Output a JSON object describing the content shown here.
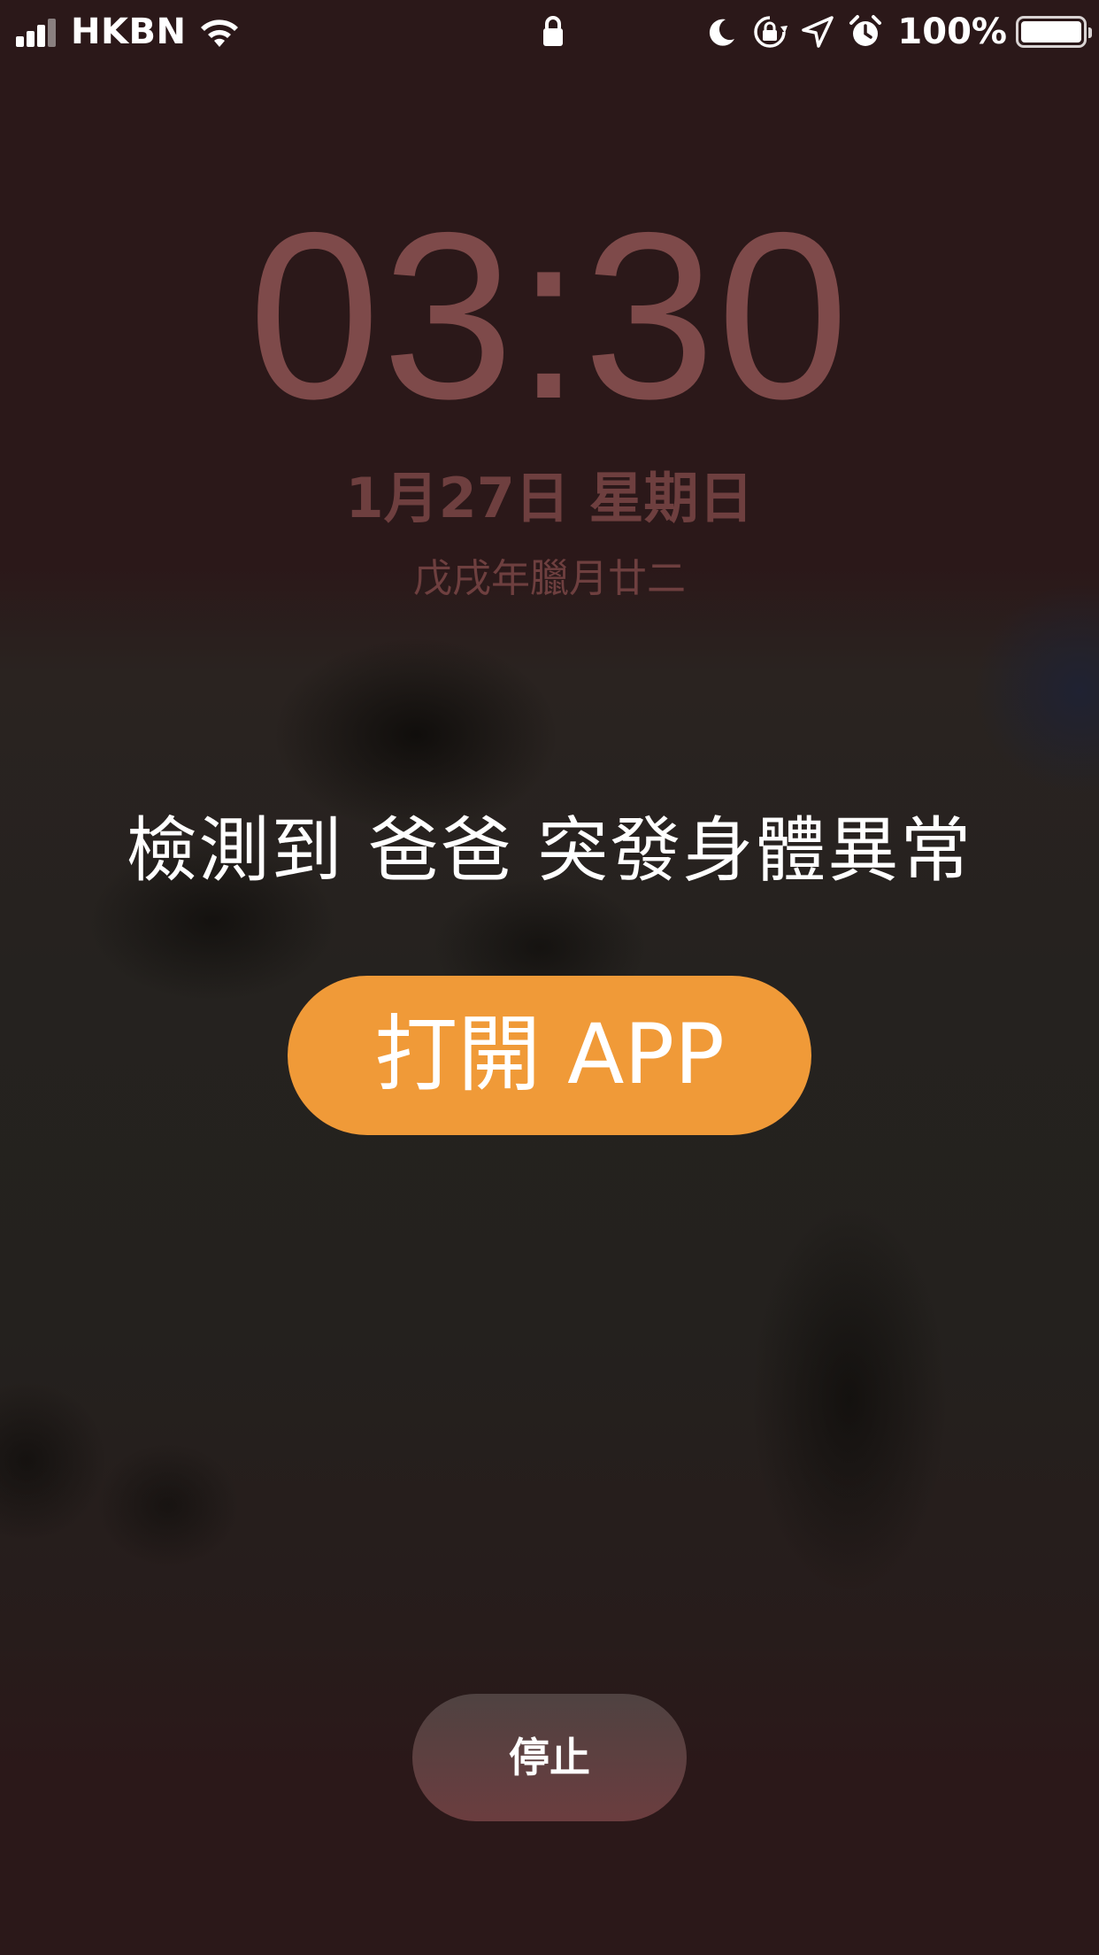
{
  "status_bar": {
    "carrier": "HKBN",
    "battery_percent": "100%",
    "signal_bars": 4,
    "signal_bars_active": 3,
    "icons": [
      "signal-icon",
      "wifi-icon",
      "lock-icon",
      "moon-icon",
      "rotation-lock-icon",
      "location-icon",
      "alarm-icon",
      "battery-icon"
    ]
  },
  "lock_screen": {
    "time": "03:30",
    "date": "1月27日 星期日",
    "lunar_date": "戊戌年臘月廿二"
  },
  "alert": {
    "message": "檢測到 爸爸 突發身體異常",
    "open_app_label": "打開 APP",
    "stop_label": "停止"
  },
  "colors": {
    "background": "#2b1819",
    "clock_text": "#7e4a4a",
    "accent_button": "#f09a38",
    "stop_button": "#6b3d3f"
  }
}
